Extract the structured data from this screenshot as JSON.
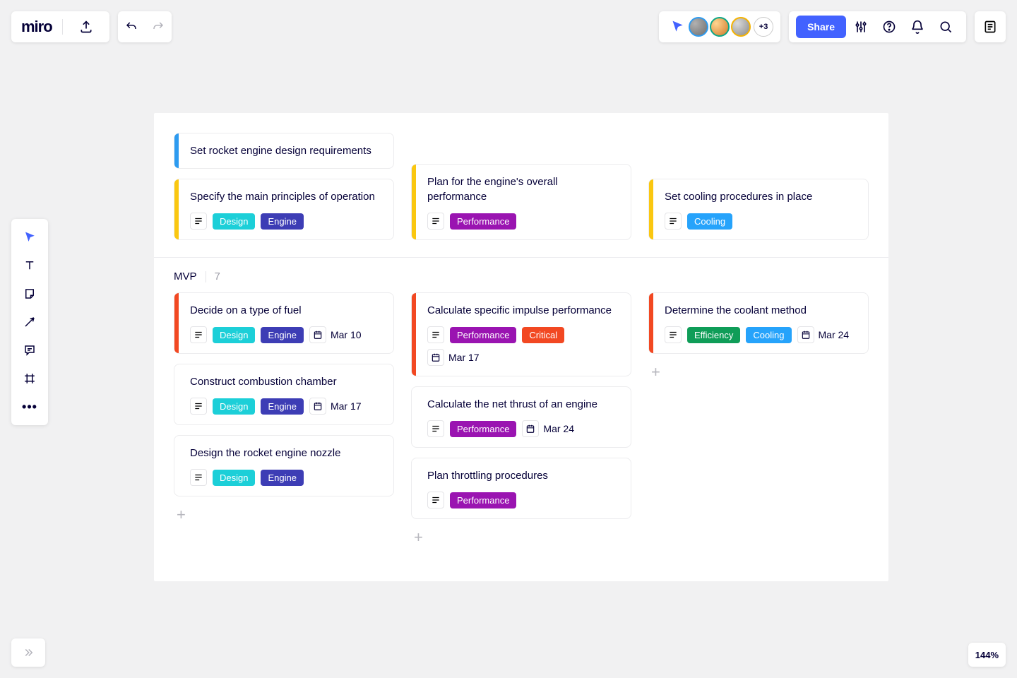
{
  "brand": "miro",
  "share_label": "Share",
  "presence_extra": "+3",
  "zoom": "144%",
  "section": {
    "name": "MVP",
    "count": "7"
  },
  "tag_colors": {
    "Design": "#1ccfd8",
    "Engine": "#3d3db5",
    "Performance": "#9a14b1",
    "Cooling": "#26a3fb",
    "Critical": "#f24822",
    "Efficiency": "#0f9d58"
  },
  "stripe_colors": {
    "blue": "#2d9bf0",
    "yellow": "#fac710",
    "red": "#f24822",
    "none": "transparent"
  },
  "group1": {
    "col1": [
      {
        "title": "Set rocket engine design requirements",
        "stripe": "blue",
        "tags": [],
        "date": ""
      },
      {
        "title": "Specify the main principles of operation",
        "stripe": "yellow",
        "tags": [
          "Design",
          "Engine"
        ],
        "date": ""
      }
    ],
    "col2": [
      {
        "title": "Plan for the engine's overall performance",
        "stripe": "yellow",
        "tags": [
          "Performance"
        ],
        "date": ""
      }
    ],
    "col3": [
      {
        "title": "Set cooling procedures in place",
        "stripe": "yellow",
        "tags": [
          "Cooling"
        ],
        "date": ""
      }
    ]
  },
  "group2": {
    "col1": [
      {
        "title": "Decide on a type of fuel",
        "stripe": "red",
        "tags": [
          "Design",
          "Engine"
        ],
        "date": "Mar 10"
      },
      {
        "title": "Construct combustion chamber",
        "stripe": "none",
        "tags": [
          "Design",
          "Engine"
        ],
        "date": "Mar 17"
      },
      {
        "title": "Design the rocket engine nozzle",
        "stripe": "none",
        "tags": [
          "Design",
          "Engine"
        ],
        "date": ""
      }
    ],
    "col2": [
      {
        "title": "Calculate specific impulse performance",
        "stripe": "red",
        "tags": [
          "Performance",
          "Critical"
        ],
        "date": "Mar 17"
      },
      {
        "title": "Calculate the net thrust of an engine",
        "stripe": "none",
        "tags": [
          "Performance"
        ],
        "date": "Mar 24"
      },
      {
        "title": "Plan throttling procedures",
        "stripe": "none",
        "tags": [
          "Performance"
        ],
        "date": ""
      }
    ],
    "col3": [
      {
        "title": "Determine the coolant method",
        "stripe": "red",
        "tags": [
          "Efficiency",
          "Cooling"
        ],
        "date": "Mar 24"
      }
    ]
  }
}
